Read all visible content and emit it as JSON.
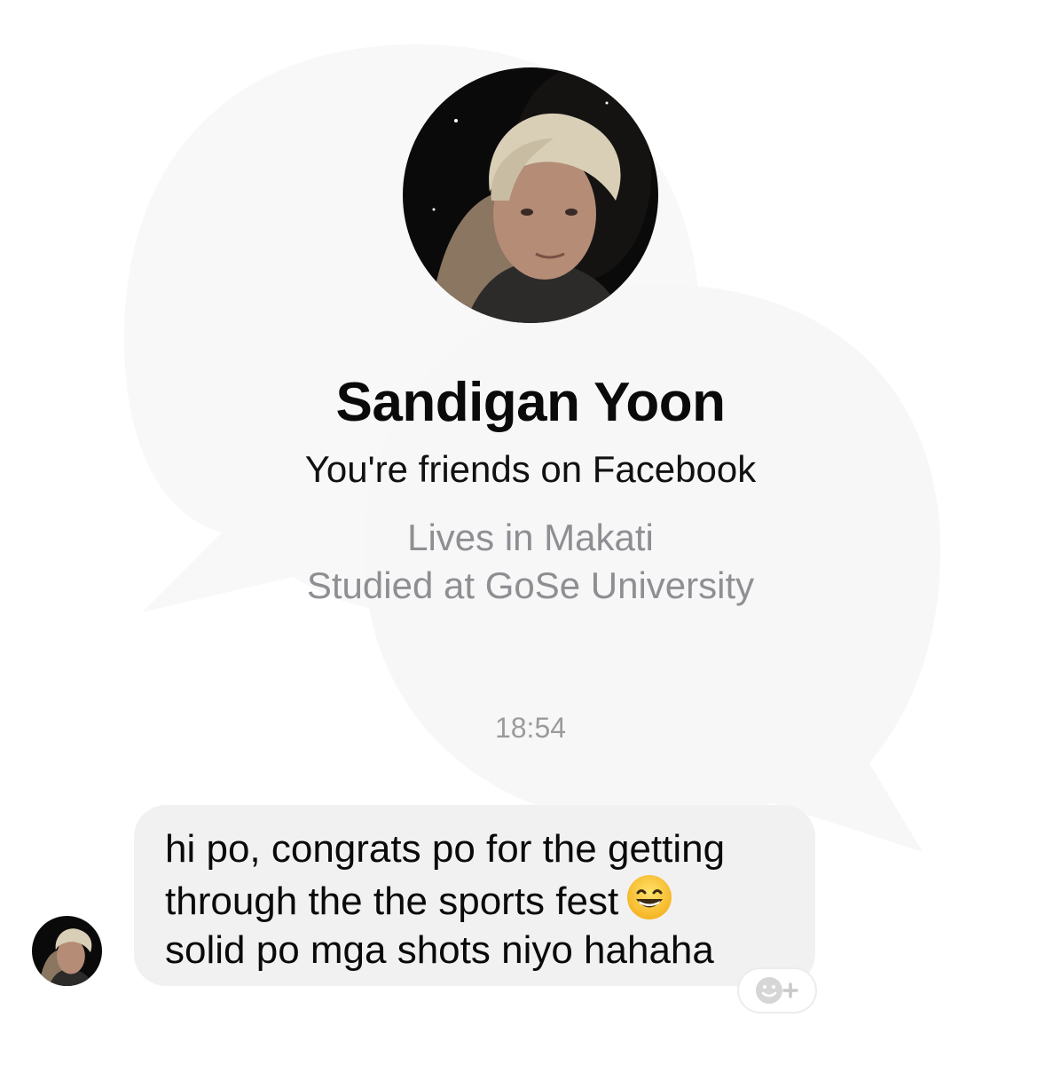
{
  "contact": {
    "name": "Sandigan Yoon",
    "relationship": "You're friends on Facebook",
    "lives_in": "Lives in Makati",
    "studied_at": "Studied at GoSe University"
  },
  "conversation": {
    "timestamp": "18:54",
    "messages": [
      {
        "lines": [
          "hi po, congrats po for the getting",
          "through the the sports fest",
          "solid po mga shots niyo hahaha"
        ],
        "emoji": "😁",
        "emoji_name": "grinning-face-with-smiling-eyes"
      }
    ]
  },
  "icons": {
    "react": "add-reaction-icon",
    "avatar": "profile-photo"
  },
  "colors": {
    "bubble_bg": "#f1f1f2",
    "muted_text": "#8e8e93",
    "watermark": "#f7f7f7"
  }
}
